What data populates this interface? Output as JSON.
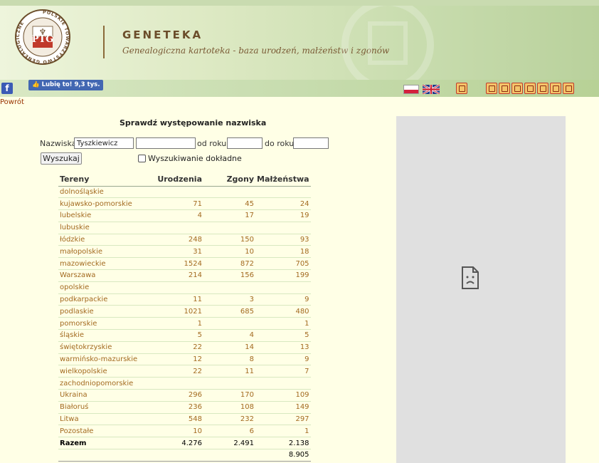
{
  "header": {
    "title": "GENETEKA",
    "subtitle": "Genealogiczna kartoteka - baza urodzeń, małżeństw i zgonów",
    "logo_icon": "ptg-seal-logo",
    "logo_text": "POLSKIE TOWARZYSTWO GENEALOGICZNE"
  },
  "toolbar": {
    "facebook_icon": "facebook-icon",
    "like_label": "Lubię to! 9,3 tys.",
    "languages": [
      "pl-flag",
      "en-flag"
    ],
    "icons": [
      "home-icon",
      "tool-icon-1",
      "tool-icon-2",
      "tool-icon-3",
      "tool-icon-4",
      "tool-icon-5",
      "tool-icon-6",
      "tool-icon-7"
    ]
  },
  "back_link": "Powrót",
  "search": {
    "title": "Sprawdź występowanie nazwiska",
    "surname_label": "Nazwiska",
    "surname_value": "Tyszkiewicz",
    "surname2_value": "",
    "from_label": "od roku",
    "from_value": "",
    "to_label": "do roku",
    "to_value": "",
    "button_label": "Wyszukaj",
    "exact_label": "Wyszukiwanie dokładne",
    "exact_checked": false
  },
  "table": {
    "headers": [
      "Tereny",
      "Urodzenia",
      "Zgony",
      "Małżeństwa"
    ],
    "rows": [
      [
        "dolnośląskie",
        "",
        "",
        ""
      ],
      [
        "kujawsko-pomorskie",
        "71",
        "45",
        "24"
      ],
      [
        "lubelskie",
        "4",
        "17",
        "19"
      ],
      [
        "lubuskie",
        "",
        "",
        ""
      ],
      [
        "łódzkie",
        "248",
        "150",
        "93"
      ],
      [
        "małopolskie",
        "31",
        "10",
        "18"
      ],
      [
        "mazowieckie",
        "1524",
        "872",
        "705"
      ],
      [
        "Warszawa",
        "214",
        "156",
        "199"
      ],
      [
        "opolskie",
        "",
        "",
        ""
      ],
      [
        "podkarpackie",
        "11",
        "3",
        "9"
      ],
      [
        "podlaskie",
        "1021",
        "685",
        "480"
      ],
      [
        "pomorskie",
        "1",
        "",
        "1"
      ],
      [
        "śląskie",
        "5",
        "4",
        "5"
      ],
      [
        "świętokrzyskie",
        "22",
        "14",
        "13"
      ],
      [
        "warmińsko-mazurskie",
        "12",
        "8",
        "9"
      ],
      [
        "wielkopolskie",
        "22",
        "11",
        "7"
      ],
      [
        "zachodniopomorskie",
        "",
        "",
        ""
      ],
      [
        "Ukraina",
        "296",
        "170",
        "109"
      ],
      [
        "Białoruś",
        "236",
        "108",
        "149"
      ],
      [
        "Litwa",
        "548",
        "232",
        "297"
      ],
      [
        "Pozostałe",
        "10",
        "6",
        "1"
      ]
    ],
    "total": [
      "Razem",
      "4.276",
      "2.491",
      "2.138"
    ],
    "grand_total": "8.905"
  },
  "ad_panel": {
    "icon": "broken-image-icon"
  }
}
